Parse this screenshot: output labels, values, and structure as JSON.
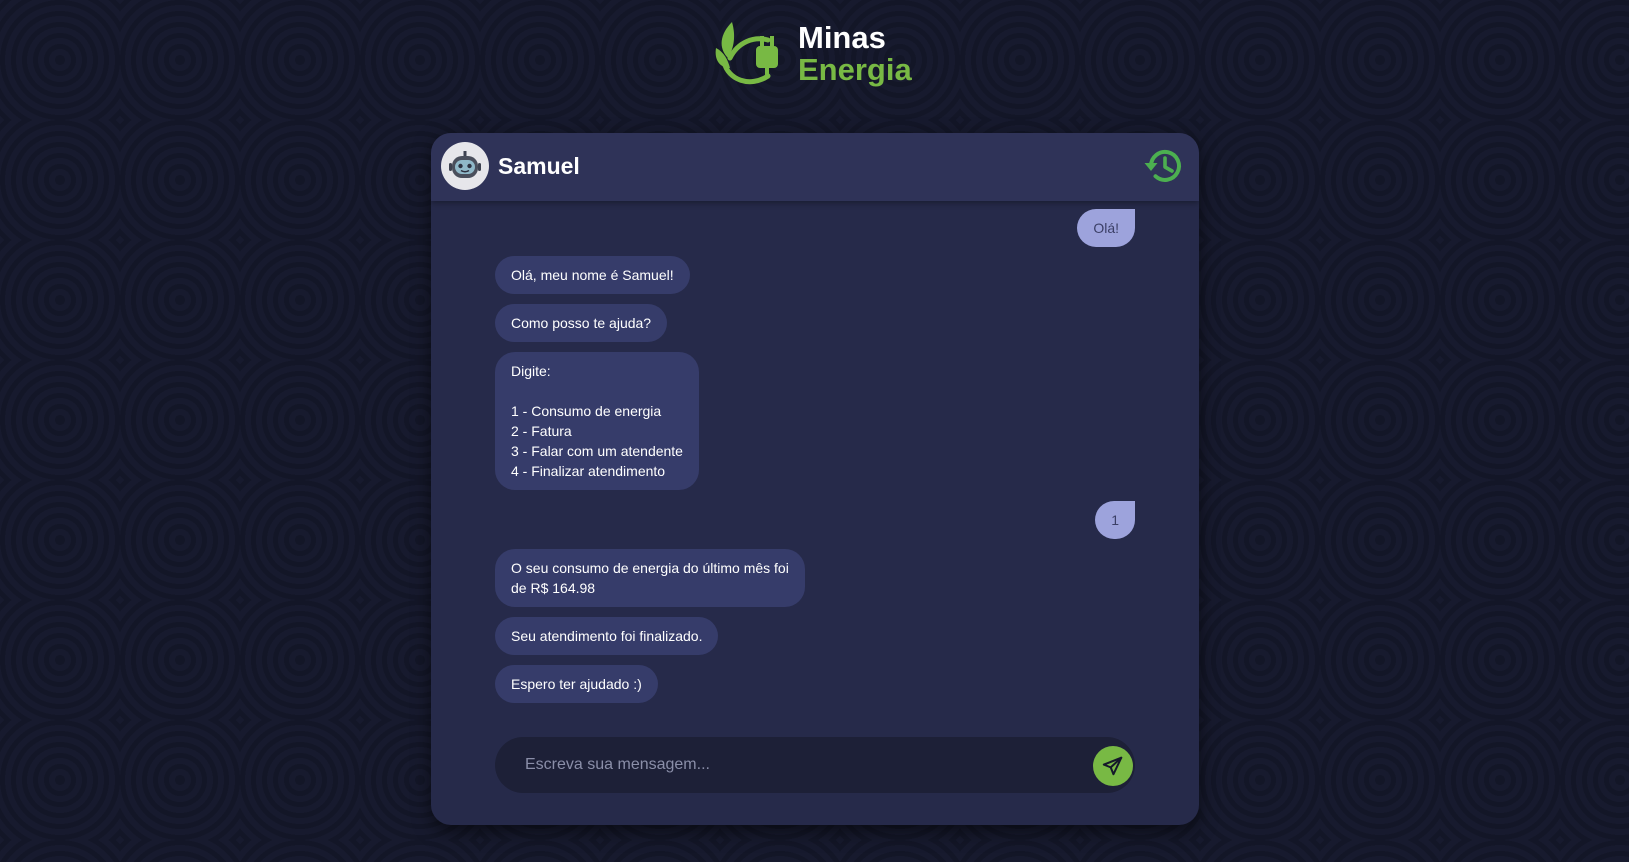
{
  "brand": {
    "line1": "Minas",
    "line2": "Energia",
    "logo_icon": "leaf-plug-icon",
    "accent_color": "#78b944"
  },
  "chat": {
    "bot_name": "Samuel",
    "avatar_icon": "robot-icon",
    "history_icon": "history-icon",
    "messages": [
      {
        "from": "user",
        "text": "Olá!"
      },
      {
        "from": "bot",
        "text": "Olá, meu nome é Samuel!"
      },
      {
        "from": "bot",
        "text": "Como posso te ajuda?"
      },
      {
        "from": "bot",
        "text": "Digite:\n\n1 - Consumo de energia\n2 - Fatura\n3 - Falar com um atendente\n4 - Finalizar atendimento"
      },
      {
        "from": "user",
        "text": "1"
      },
      {
        "from": "bot",
        "text": "O seu consumo de energia do último mês foi\nde R$ 164.98"
      },
      {
        "from": "bot",
        "text": "Seu atendimento foi finalizado."
      },
      {
        "from": "bot",
        "text": "Espero ter ajudado :)"
      }
    ]
  },
  "composer": {
    "placeholder": "Escreva sua mensagem...",
    "value": "",
    "send_icon": "send-icon"
  }
}
